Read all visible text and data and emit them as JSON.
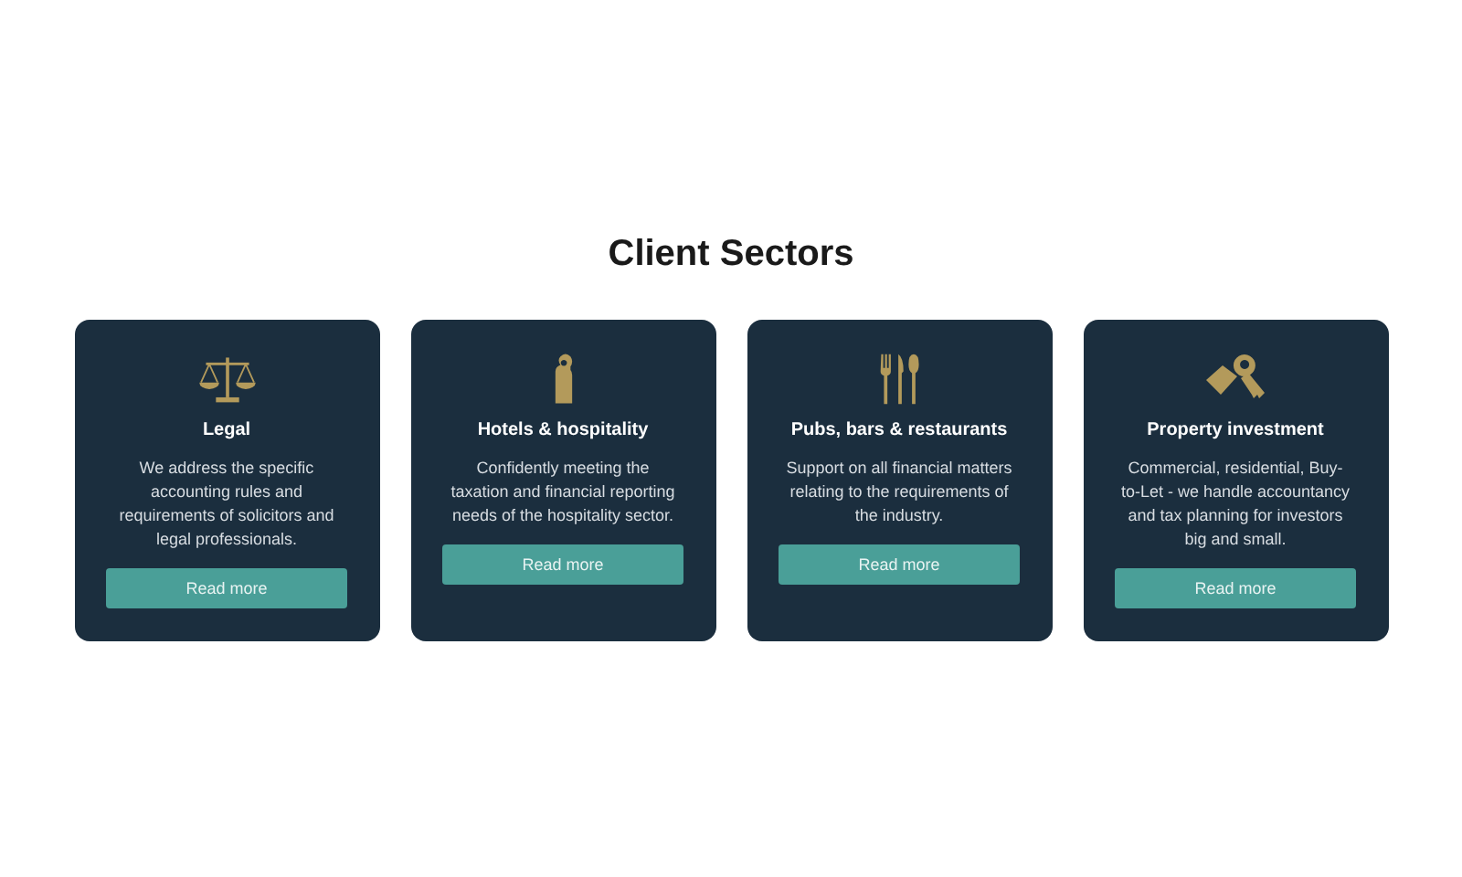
{
  "heading": "Client Sectors",
  "cards": [
    {
      "kind": "scales",
      "title": "Legal",
      "text": "We address the specific accounting rules and requirements of solicitors and legal professionals.",
      "button": "Read more"
    },
    {
      "kind": "door-hanger",
      "title": "Hotels & hospitality",
      "text": "Confidently meeting the taxation and financial reporting needs of the hospitality sector.",
      "button": "Read more"
    },
    {
      "kind": "cutlery",
      "title": "Pubs, bars & restaurants",
      "text": "Support on all financial matters relating to the requirements of the industry.",
      "button": "Read more"
    },
    {
      "kind": "keys",
      "title": "Property investment",
      "text": "Commercial, residential, Buy-to-Let - we handle accountancy and tax planning for investors big and small.",
      "button": "Read more"
    }
  ]
}
